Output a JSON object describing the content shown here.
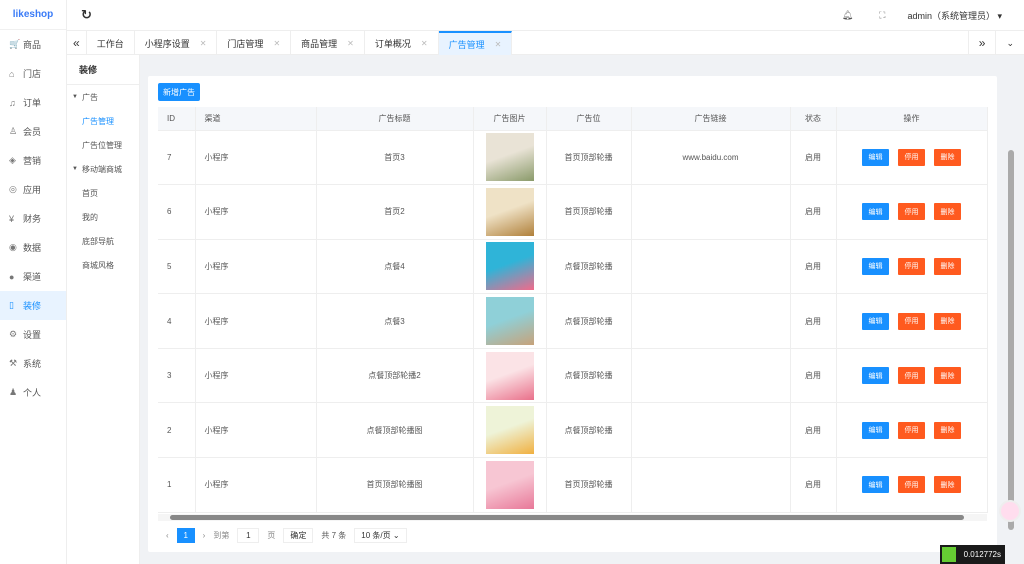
{
  "brand": "likeshop",
  "sidebar": [
    {
      "icon": "cart-icon",
      "g": "🛒",
      "label": "商品"
    },
    {
      "icon": "store-icon",
      "g": "⌂",
      "label": "门店"
    },
    {
      "icon": "bell-icon",
      "g": "♫",
      "label": "订单"
    },
    {
      "icon": "user-icon",
      "g": "♙",
      "label": "会员"
    },
    {
      "icon": "marketing-icon",
      "g": "◈",
      "label": "营销"
    },
    {
      "icon": "app-icon",
      "g": "◎",
      "label": "应用"
    },
    {
      "icon": "finance-icon",
      "g": "¥",
      "label": "财务"
    },
    {
      "icon": "data-icon",
      "g": "◉",
      "label": "数据"
    },
    {
      "icon": "channel-icon",
      "g": "●",
      "label": "渠道"
    },
    {
      "icon": "decorate-icon",
      "g": "▯",
      "label": "装修"
    },
    {
      "icon": "settings-icon",
      "g": "⚙",
      "label": "设置"
    },
    {
      "icon": "system-icon",
      "g": "⚒",
      "label": "系统"
    },
    {
      "icon": "person-icon",
      "g": "♟",
      "label": "个人"
    }
  ],
  "header": {
    "user": "admin（系统管理员）"
  },
  "tabs": [
    {
      "label": "工作台",
      "closable": false
    },
    {
      "label": "小程序设置",
      "closable": true
    },
    {
      "label": "门店管理",
      "closable": true
    },
    {
      "label": "商品管理",
      "closable": true
    },
    {
      "label": "订单概况",
      "closable": true
    },
    {
      "label": "广告管理",
      "closable": true
    }
  ],
  "subnav": {
    "title": "装修",
    "groups": [
      {
        "label": "广告",
        "items": [
          "广告管理",
          "广告位管理"
        ]
      },
      {
        "label": "移动端商城",
        "items": [
          "首页",
          "我的",
          "底部导航",
          "商城风格"
        ]
      }
    ]
  },
  "add_button": "新增广告",
  "columns": [
    "ID",
    "渠道",
    "广告标题",
    "广告图片",
    "广告位",
    "广告链接",
    "状态",
    "操作"
  ],
  "actions": {
    "edit": "编辑",
    "disable": "停用",
    "delete": "删除"
  },
  "rows": [
    {
      "id": "7",
      "channel": "小程序",
      "title": "首页3",
      "pos": "首页顶部轮播",
      "link": "www.baidu.com",
      "status": "启用",
      "c1": "#e9e3d6",
      "c2": "#8a9a6a"
    },
    {
      "id": "6",
      "channel": "小程序",
      "title": "首页2",
      "pos": "首页顶部轮播",
      "link": "",
      "status": "启用",
      "c1": "#efe2c6",
      "c2": "#b0803a"
    },
    {
      "id": "5",
      "channel": "小程序",
      "title": "点餐4",
      "pos": "点餐顶部轮播",
      "link": "",
      "status": "启用",
      "c1": "#2fb4d8",
      "c2": "#f26a8a"
    },
    {
      "id": "4",
      "channel": "小程序",
      "title": "点餐3",
      "pos": "点餐顶部轮播",
      "link": "",
      "status": "启用",
      "c1": "#8fd0d8",
      "c2": "#c7a27a"
    },
    {
      "id": "3",
      "channel": "小程序",
      "title": "点餐顶部轮播2",
      "pos": "点餐顶部轮播",
      "link": "",
      "status": "启用",
      "c1": "#fbe3e6",
      "c2": "#e9708a"
    },
    {
      "id": "2",
      "channel": "小程序",
      "title": "点餐顶部轮播图",
      "pos": "点餐顶部轮播",
      "link": "",
      "status": "启用",
      "c1": "#eef3d8",
      "c2": "#f0b040"
    },
    {
      "id": "1",
      "channel": "小程序",
      "title": "首页顶部轮播图",
      "pos": "首页顶部轮播",
      "link": "",
      "status": "启用",
      "c1": "#f7c6d3",
      "c2": "#e87898"
    }
  ],
  "pagination": {
    "current": "1",
    "goto_label": "到第",
    "goto_value": "1",
    "page_unit": "页",
    "confirm": "确定",
    "total": "共 7 条",
    "page_size": "10 条/页"
  },
  "timer": "0.012772s"
}
